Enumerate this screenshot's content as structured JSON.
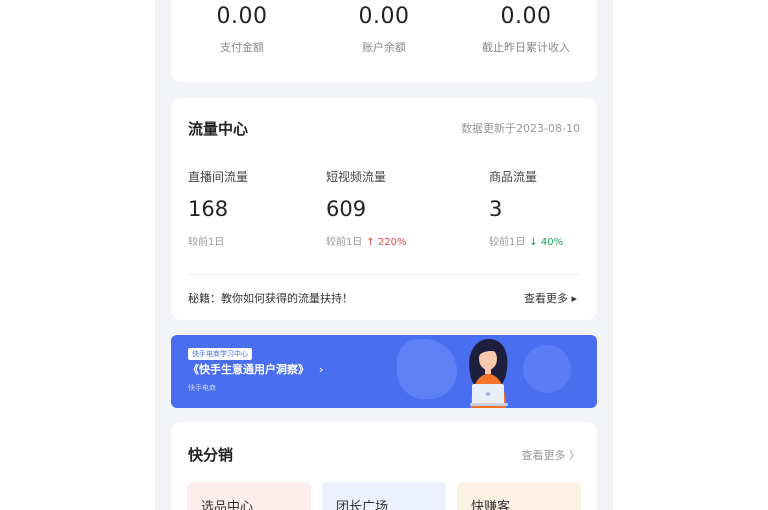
{
  "stats": [
    {
      "value": "0.00",
      "label": "支付金额"
    },
    {
      "value": "0.00",
      "label": "账户余额"
    },
    {
      "value": "0.00",
      "label": "截止昨日累计收入"
    }
  ],
  "flow": {
    "title": "流量中心",
    "date": "数据更新于2023-08-10",
    "metrics": [
      {
        "label": "直播间流量",
        "value": "168",
        "compare": "较前1日",
        "change": ""
      },
      {
        "label": "短视频流量",
        "value": "609",
        "compare": "较前1日",
        "change": "↑ 220%"
      },
      {
        "label": "商品流量",
        "value": "3",
        "compare": "较前1日",
        "change": "↓ 40%"
      }
    ],
    "tip": "秘籍：教你如何获得的流量扶持！",
    "tip_link": "查看更多 ▸"
  },
  "banner": {
    "tag": "快手电商学习中心",
    "title": "《快手生意通用户洞察》",
    "arrow": "›",
    "subtitle": "快手电商"
  },
  "kuaifenxiao": {
    "title": "快分销",
    "more": "查看更多 〉",
    "tiles": [
      "选品中心",
      "团长广场",
      "快赚客"
    ]
  },
  "colors": {
    "accent": "#4a6ef0",
    "up": "#e5484d",
    "down": "#18a058"
  }
}
